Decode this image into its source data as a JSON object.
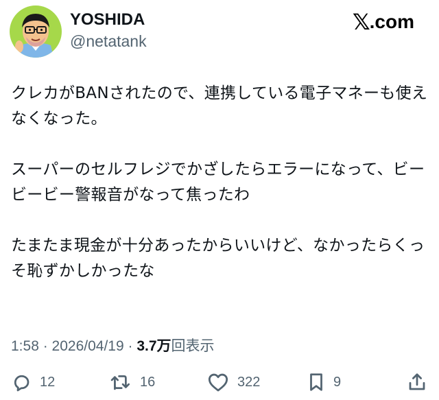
{
  "author": {
    "display_name": "YOSHIDA",
    "handle": "@netatank"
  },
  "brand": {
    "logo_glyph": "𝕏",
    "logo_suffix": ".com"
  },
  "tweet": {
    "paragraphs": [
      "クレカがBANされたので、連携している電子マネーも使えなくなった。",
      "スーパーのセルフレジでかざしたらエラーになって、ビービービー警報音がなって焦ったわ",
      "たまたま現金が十分あったからいいけど、なかったらくっそ恥ずかしかったな"
    ]
  },
  "meta": {
    "time": "1:58",
    "separator": " · ",
    "date": "2026/04/19",
    "views_count": "3.7万",
    "views_label": "回表示"
  },
  "actions": {
    "replies": "12",
    "reposts": "16",
    "likes": "322",
    "bookmarks": "9"
  },
  "colors": {
    "text": "#0f1419",
    "secondary": "#536471",
    "avatar_bg": "#a6d84a"
  }
}
